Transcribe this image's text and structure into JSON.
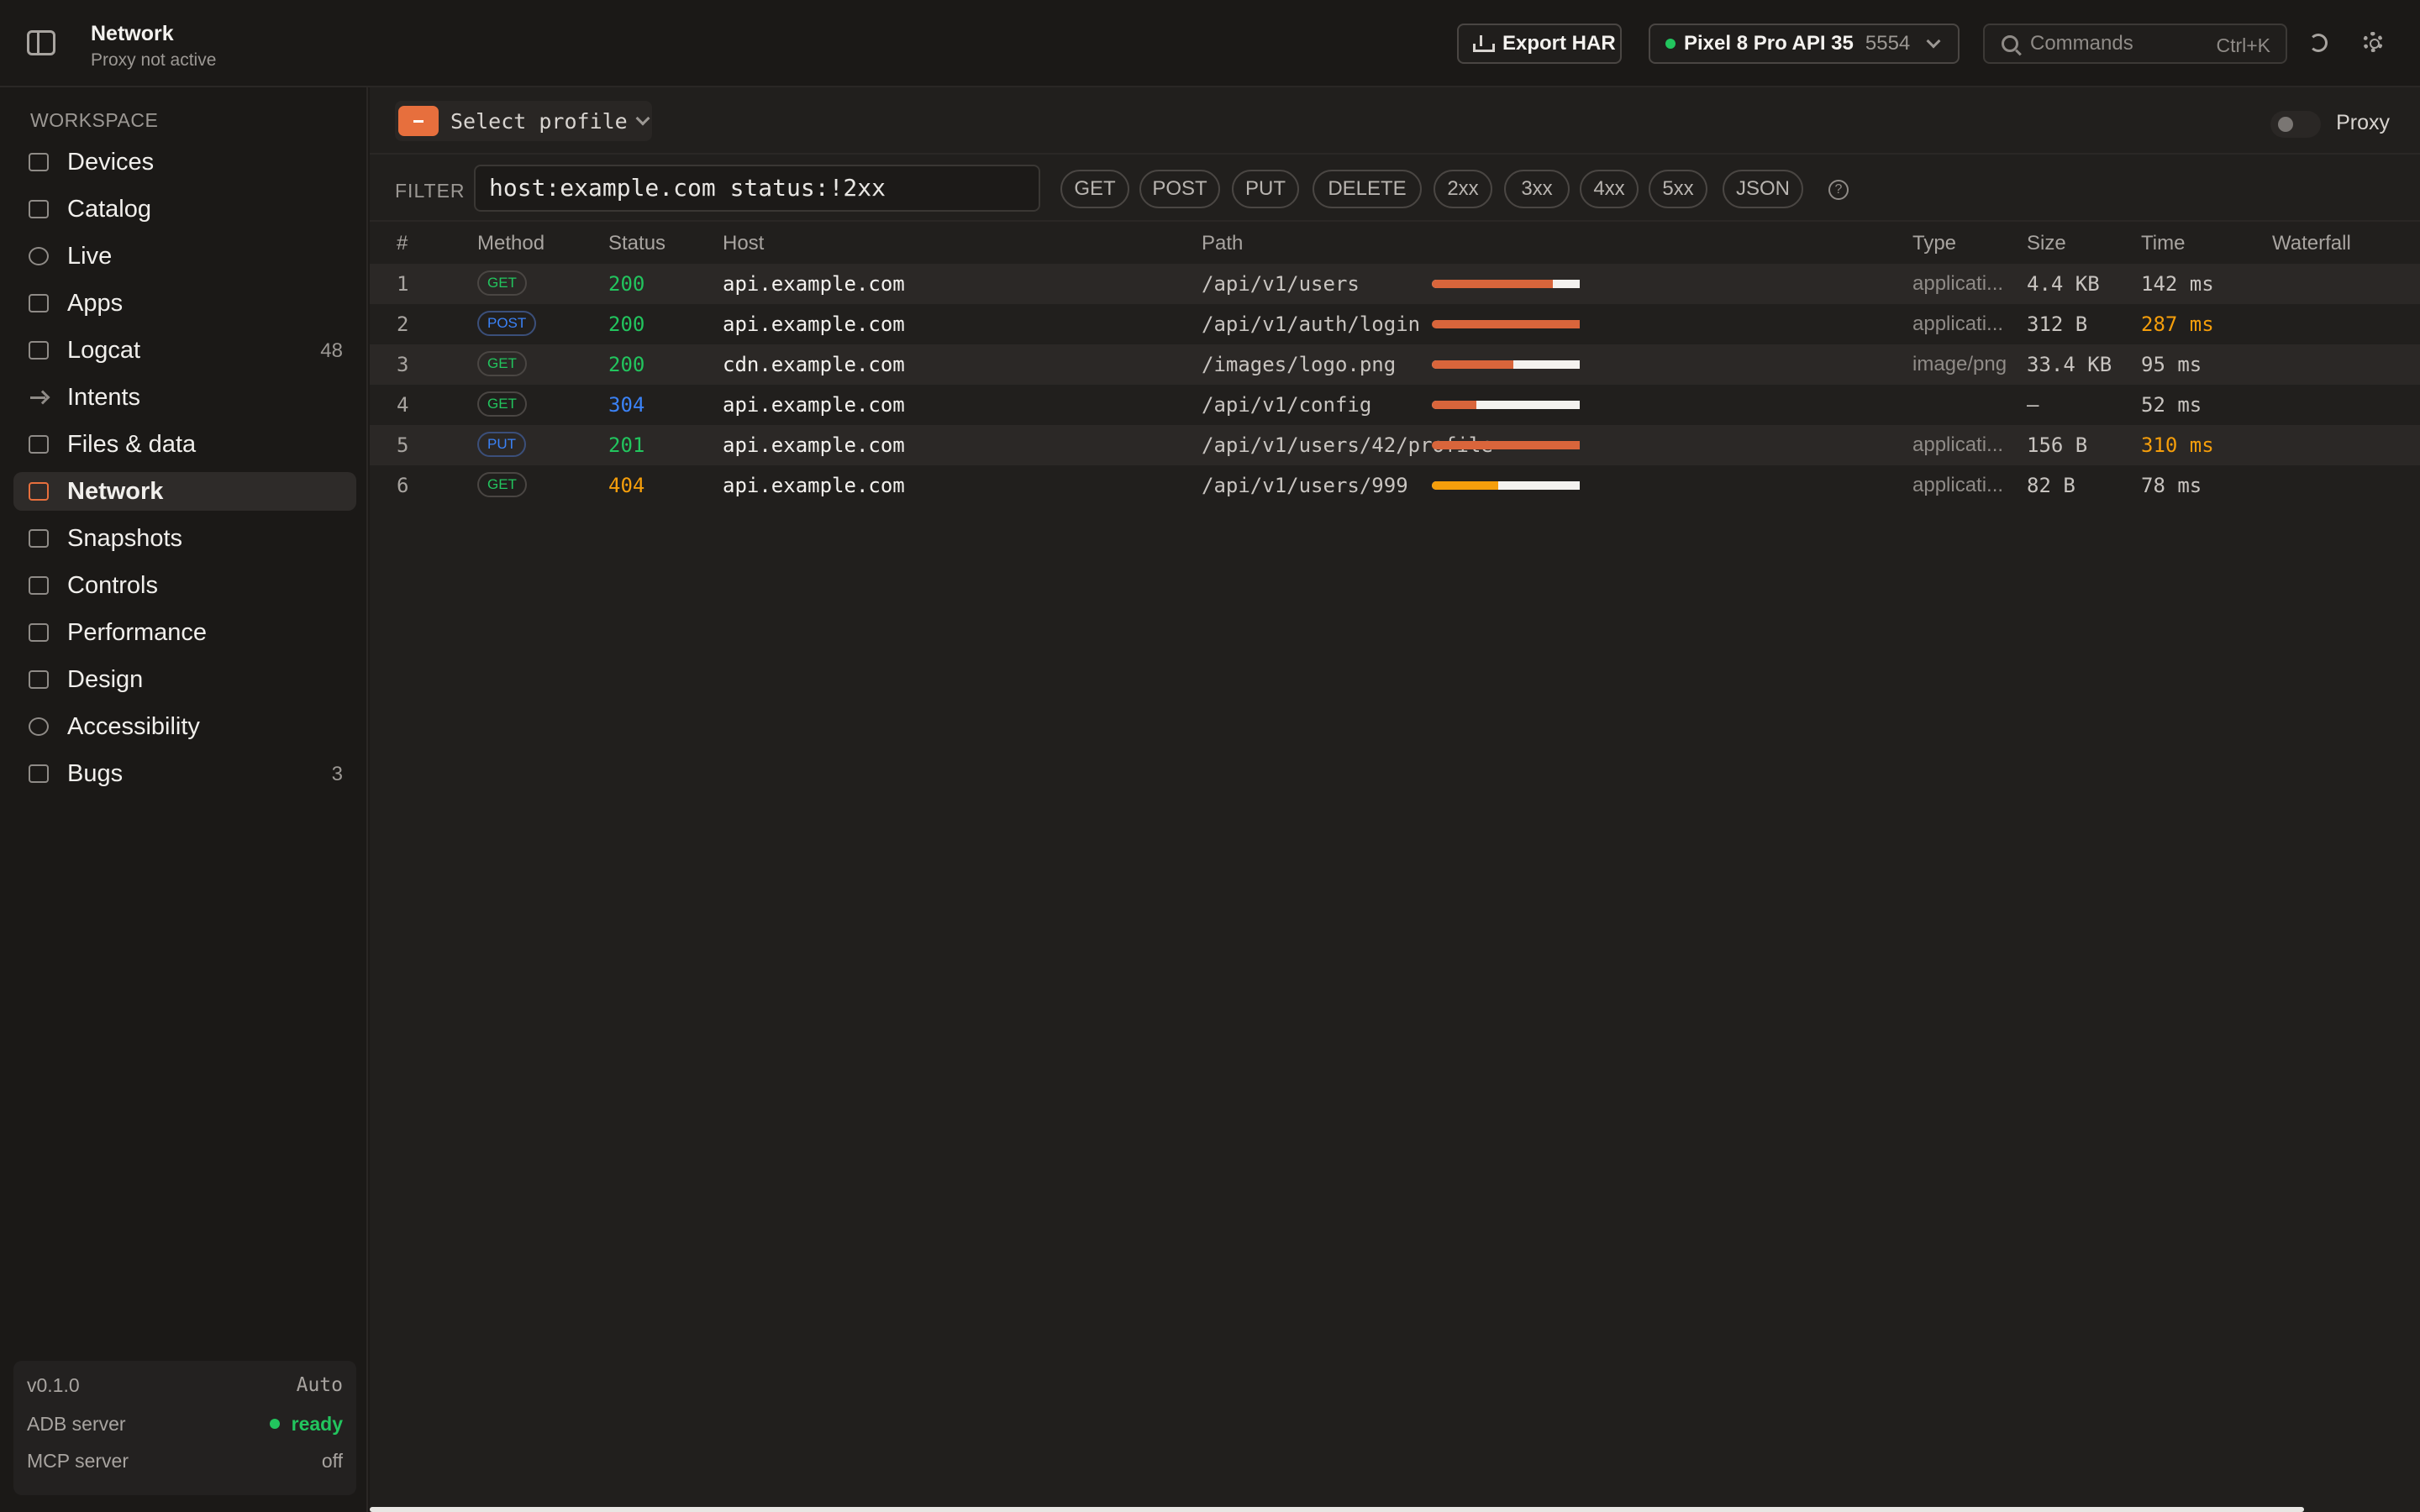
{
  "header": {
    "title": "Network",
    "subtitle": "Proxy not active",
    "export_label": "Export HAR",
    "device_name": "Pixel 8 Pro API 35",
    "device_port": "5554",
    "search_placeholder": "Commands",
    "search_shortcut": "Ctrl+K"
  },
  "sidebar": {
    "section_label": "WORKSPACE",
    "items": [
      {
        "label": "Devices",
        "icon": "devices-icon",
        "count": ""
      },
      {
        "label": "Catalog",
        "icon": "catalog-icon",
        "count": ""
      },
      {
        "label": "Live",
        "icon": "live-icon",
        "count": ""
      },
      {
        "label": "Apps",
        "icon": "apps-icon",
        "count": ""
      },
      {
        "label": "Logcat",
        "icon": "logcat-icon",
        "count": "48"
      },
      {
        "label": "Intents",
        "icon": "arrow-right-icon",
        "count": ""
      },
      {
        "label": "Files & data",
        "icon": "folder-icon",
        "count": ""
      },
      {
        "label": "Network",
        "icon": "network-icon",
        "count": "",
        "active": true
      },
      {
        "label": "Snapshots",
        "icon": "snapshots-icon",
        "count": ""
      },
      {
        "label": "Controls",
        "icon": "sliders-icon",
        "count": ""
      },
      {
        "label": "Performance",
        "icon": "chart-icon",
        "count": ""
      },
      {
        "label": "Design",
        "icon": "design-icon",
        "count": ""
      },
      {
        "label": "Accessibility",
        "icon": "accessibility-icon",
        "count": ""
      },
      {
        "label": "Bugs",
        "icon": "bug-icon",
        "count": "3"
      }
    ],
    "status": {
      "version": "v0.1.0",
      "theme": "Auto",
      "adb_label": "ADB server",
      "adb_value": "ready",
      "mcp_label": "MCP server",
      "mcp_value": "off"
    }
  },
  "toolbar": {
    "profile_label": "Select profile",
    "proxy_label": "Proxy",
    "proxy_on": false
  },
  "filter": {
    "label": "FILTER",
    "value": "host:example.com status:!2xx",
    "chips": [
      "GET",
      "POST",
      "PUT",
      "DELETE",
      "2xx",
      "3xx",
      "4xx",
      "5xx",
      "JSON"
    ],
    "help": "?"
  },
  "table": {
    "columns": [
      "#",
      "Method",
      "Status",
      "Host",
      "Path",
      "Type",
      "Size",
      "Time",
      "Waterfall"
    ],
    "rows": [
      {
        "n": "1",
        "method": "GET",
        "status": "200",
        "host": "api.example.com",
        "path": "/api/v1/users",
        "type": "applicati...",
        "size": "4.4 KB",
        "time": "142 ms",
        "slow": false,
        "waterfall": 0.82
      },
      {
        "n": "2",
        "method": "POST",
        "status": "200",
        "host": "api.example.com",
        "path": "/api/v1/auth/login",
        "type": "applicati...",
        "size": "312 B",
        "time": "287 ms",
        "slow": true,
        "waterfall": 1.0
      },
      {
        "n": "3",
        "method": "GET",
        "status": "200",
        "host": "cdn.example.com",
        "path": "/images/logo.png",
        "type": "image/png",
        "size": "33.4 KB",
        "time": "95 ms",
        "slow": false,
        "waterfall": 0.55
      },
      {
        "n": "4",
        "method": "GET",
        "status": "304",
        "host": "api.example.com",
        "path": "/api/v1/config",
        "type": "",
        "size": "–",
        "time": "52 ms",
        "slow": false,
        "waterfall": 0.3
      },
      {
        "n": "5",
        "method": "PUT",
        "status": "201",
        "host": "api.example.com",
        "path": "/api/v1/users/42/profile",
        "type": "applicati...",
        "size": "156 B",
        "time": "310 ms",
        "slow": true,
        "waterfall": 1.0
      },
      {
        "n": "6",
        "method": "GET",
        "status": "404",
        "host": "api.example.com",
        "path": "/api/v1/users/999",
        "type": "applicati...",
        "size": "82 B",
        "time": "78 ms",
        "slow": false,
        "waterfall": 0.45
      }
    ]
  },
  "colors": {
    "accent": "#e76f3d",
    "ok": "#22c55e",
    "info": "#3b82f6",
    "warn": "#f59e0b"
  }
}
